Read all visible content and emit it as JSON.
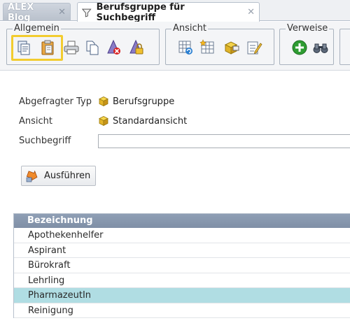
{
  "tabs": [
    {
      "label": "ALEX Blog",
      "active": false
    },
    {
      "label": "Berufsgruppe für Suchbegriff",
      "active": true
    }
  ],
  "toolbar": {
    "groups": [
      {
        "legend": "Allgemein"
      },
      {
        "legend": "Ansicht"
      },
      {
        "legend": "Verweise"
      }
    ]
  },
  "form": {
    "type_label": "Abgefragter Typ",
    "type_value": "Berufsgruppe",
    "view_label": "Ansicht",
    "view_value": "Standardansicht",
    "search_label": "Suchbegriff",
    "search_value": ""
  },
  "run_button": {
    "label": "Ausführen"
  },
  "table": {
    "header": "Bezeichnung",
    "rows": [
      "Apothekenhelfer",
      "Aspirant",
      "Bürokraft",
      "Lehrling",
      "PharmazeutIn",
      "Reinigung"
    ],
    "selected_row": "PharmazeutIn"
  },
  "colors": {
    "highlight": "#f2cc2f",
    "table_header": "#8a9ab0",
    "selected_row": "#b0dde3"
  }
}
